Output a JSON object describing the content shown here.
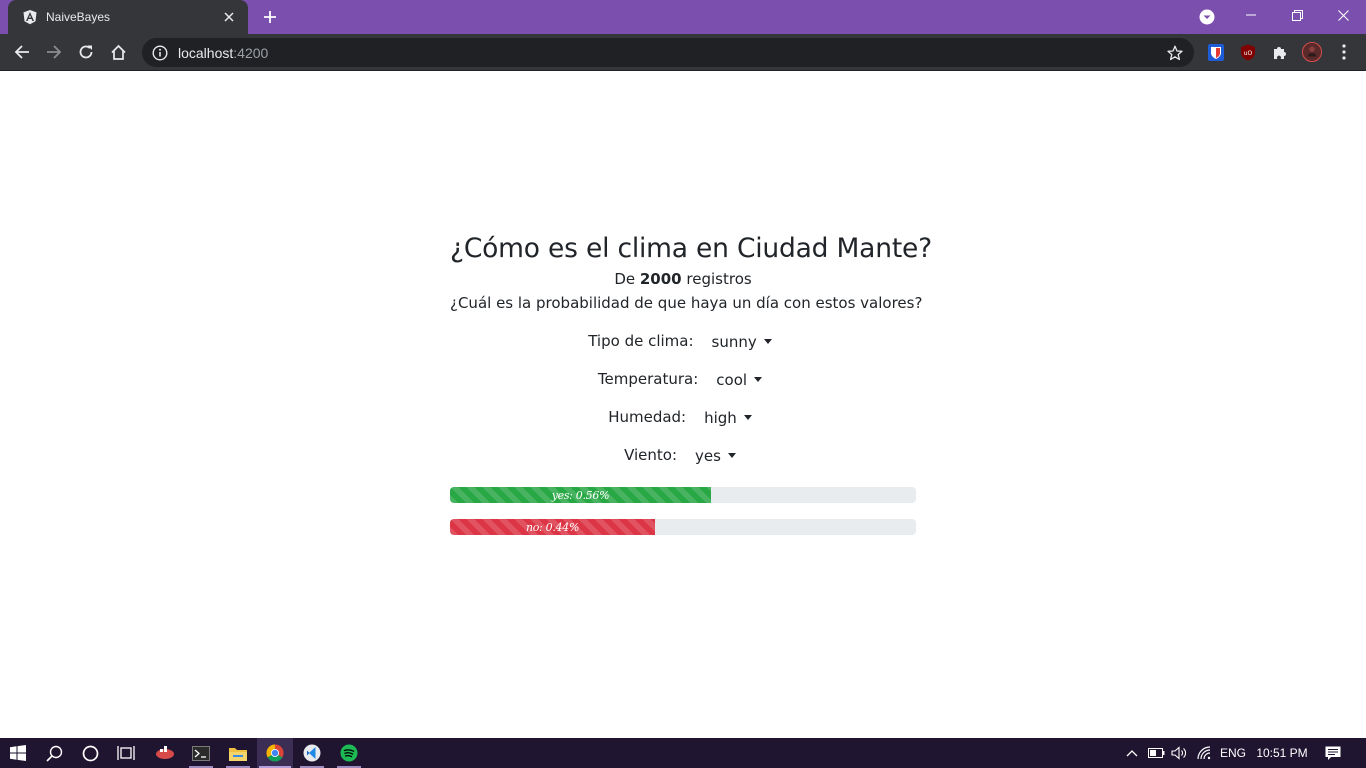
{
  "browser": {
    "tab_title": "NaiveBayes",
    "url_host": "localhost",
    "url_port": ":4200"
  },
  "page": {
    "title": "¿Cómo es el clima en Ciudad Mante?",
    "records_prefix": "De",
    "records_count": "2000",
    "records_suffix": "registros",
    "question": "¿Cuál es la probabilidad de que haya un día con estos valores?",
    "fields": [
      {
        "label": "Tipo de clima:",
        "value": "sunny"
      },
      {
        "label": "Temperatura:",
        "value": "cool"
      },
      {
        "label": "Humedad:",
        "value": "high"
      },
      {
        "label": "Viento:",
        "value": "yes"
      }
    ],
    "results": [
      {
        "label": "yes: 0.56%",
        "fraction": 0.56,
        "color": "#28a745"
      },
      {
        "label": "no: 0.44%",
        "fraction": 0.44,
        "color": "#dc3545"
      }
    ]
  },
  "taskbar": {
    "language": "ENG",
    "time": "10:51 PM"
  },
  "colors": {
    "tabstrip": "#7a4fae",
    "toolbar": "#35363a",
    "taskbar": "#1f1530",
    "text": "#212529"
  },
  "icons": [
    "angular-icon",
    "close-icon",
    "plus-icon",
    "tab-search-icon",
    "minimize-icon",
    "restore-icon",
    "back-icon",
    "forward-icon",
    "reload-icon",
    "home-icon",
    "info-icon",
    "star-icon",
    "extensions-icon",
    "profile-icon",
    "menu-icon",
    "windows-icon",
    "search-icon",
    "cortana-icon",
    "task-view-icon",
    "terminal-icon",
    "file-explorer-icon",
    "chrome-icon",
    "spotify-icon",
    "notification-icon"
  ]
}
